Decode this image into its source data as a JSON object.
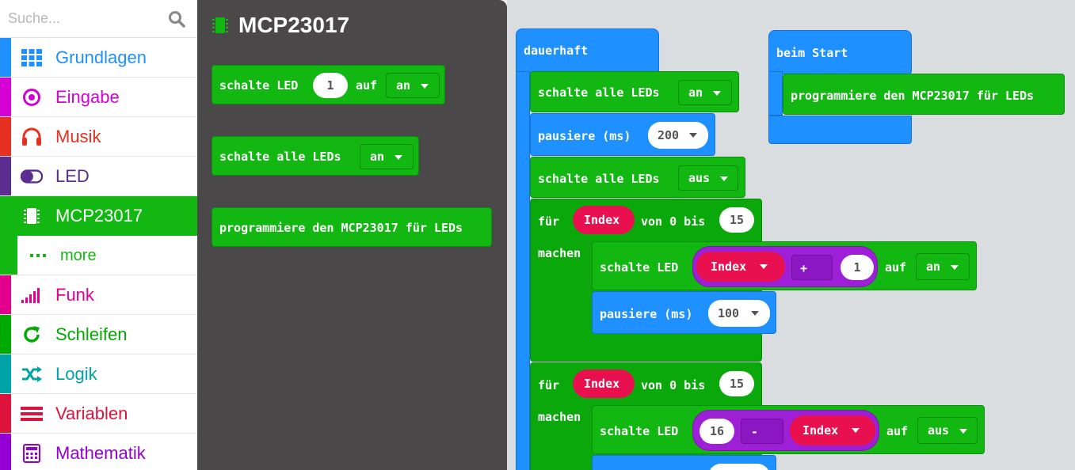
{
  "search": {
    "placeholder": "Suche..."
  },
  "colors": {
    "grundlagen": "#1e90ff",
    "eingabe": "#d400d4",
    "musik": "#e63022",
    "led": "#5c2d91",
    "mcp": "#12b712",
    "funk": "#e3008c",
    "schleifen": "#00aa00",
    "logik": "#00a4a6",
    "variablen": "#dc143c",
    "mathematik": "#9400d3"
  },
  "toolbox": {
    "categories": [
      {
        "label": "Grundlagen",
        "icon": "grid-icon"
      },
      {
        "label": "Eingabe",
        "icon": "target-icon"
      },
      {
        "label": "Musik",
        "icon": "headphones-icon"
      },
      {
        "label": "LED",
        "icon": "toggle-icon"
      },
      {
        "label": "MCP23017",
        "icon": "chip-icon"
      },
      {
        "label": "more",
        "icon": "dots-icon"
      },
      {
        "label": "Funk",
        "icon": "signal-bars-icon"
      },
      {
        "label": "Schleifen",
        "icon": "refresh-icon"
      },
      {
        "label": "Logik",
        "icon": "shuffle-icon"
      },
      {
        "label": "Variablen",
        "icon": "lines-icon"
      },
      {
        "label": "Mathematik",
        "icon": "calculator-icon"
      }
    ]
  },
  "flyout": {
    "title": "MCP23017",
    "block1": {
      "text": "schalte LED",
      "num": "1",
      "mid": "auf",
      "drop": "an"
    },
    "block2": {
      "text": "schalte alle LEDs",
      "drop": "an"
    },
    "block3": {
      "text": "programmiere den MCP23017 für LEDs"
    }
  },
  "workspace": {
    "forever": {
      "label": "dauerhaft",
      "s1": {
        "text": "schalte alle LEDs",
        "drop": "an"
      },
      "p1": {
        "text": "pausiere (ms)",
        "val": "200"
      },
      "s2": {
        "text": "schalte alle LEDs",
        "drop": "aus"
      },
      "for1": {
        "fuer": "für",
        "var": "Index",
        "von": "von 0 bis",
        "max": "15",
        "machen": "machen",
        "led": {
          "text": "schalte LED",
          "var": "Index",
          "op": "+",
          "num": "1",
          "auf": "auf",
          "drop": "an"
        },
        "pause": {
          "text": "pausiere (ms)",
          "val": "100"
        }
      },
      "for2": {
        "fuer": "für",
        "var": "Index",
        "von": "von 0 bis",
        "max": "15",
        "machen": "machen",
        "led": {
          "text": "schalte LED",
          "num": "16",
          "op": "-",
          "var": "Index",
          "auf": "auf",
          "drop": "aus"
        }
      }
    },
    "start": {
      "label": "beim Start",
      "block": {
        "text": "programmiere den MCP23017 für LEDs"
      }
    }
  }
}
